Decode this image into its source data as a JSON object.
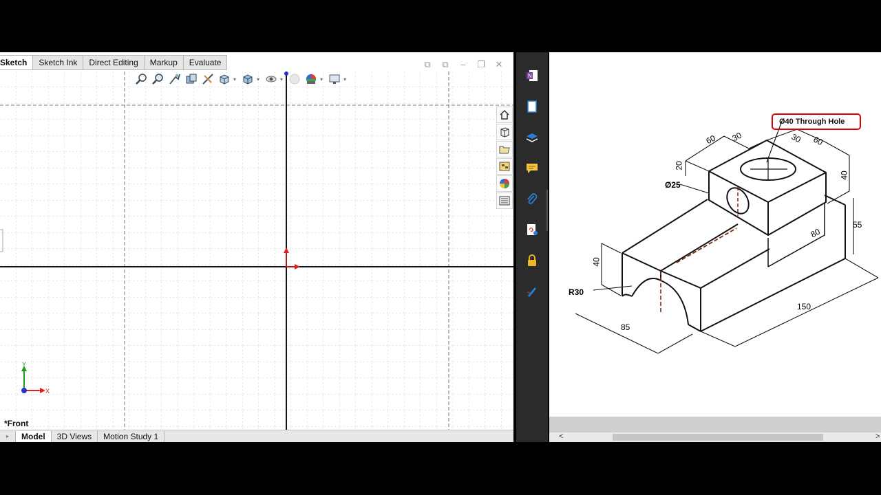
{
  "cad": {
    "ribbon_tabs": [
      {
        "label": "Sketch",
        "active": true
      },
      {
        "label": "Sketch Ink",
        "active": false
      },
      {
        "label": "Direct Editing",
        "active": false
      },
      {
        "label": "Markup",
        "active": false
      },
      {
        "label": "Evaluate",
        "active": false
      }
    ],
    "view_label": "*Front",
    "triad": {
      "x_label": "X",
      "y_label": "Y"
    },
    "bottom_tabs": [
      {
        "label": "Model",
        "active": true
      },
      {
        "label": "3D Views",
        "active": false
      },
      {
        "label": "Motion Study 1",
        "active": false
      }
    ],
    "heads_up_icons": [
      "zoom-to-fit-icon",
      "zoom-to-area-icon",
      "previous-view-icon",
      "section-view-icon",
      "dynamic-annotation-icon",
      "view-orientation-icon",
      "display-style-icon",
      "hide-show-items-icon",
      "edit-appearance-icon",
      "apply-scene-icon",
      "view-settings-icon"
    ],
    "task_pane_icons": [
      "home-icon",
      "design-library-icon",
      "file-explorer-icon",
      "view-palette-icon",
      "appearances-icon",
      "custom-properties-icon"
    ],
    "colors": {
      "x_axis": "#e02020",
      "y_axis": "#1d9c1d",
      "origin": "#2233cc"
    }
  },
  "pdf": {
    "sidebar_icons": [
      "onenote-icon",
      "page-thumbnails-icon",
      "layers-icon",
      "comments-icon",
      "attachments-icon",
      "signature-icon",
      "lock-icon",
      "fill-sign-icon"
    ],
    "drawing": {
      "callout": "Ø40 Through Hole",
      "dimensions": {
        "top_left_60": "60",
        "top_left_30": "30",
        "top_right_30": "30",
        "top_right_60": "60",
        "boss_20": "20",
        "boss_40": "40",
        "hole_25": "Ø25",
        "height_55": "55",
        "slot_80": "80",
        "left_40": "40",
        "radius": "R30",
        "width_85": "85",
        "length_150": "150"
      }
    },
    "hscroll": {
      "left_arrow": "<",
      "right_arrow": ">"
    }
  }
}
